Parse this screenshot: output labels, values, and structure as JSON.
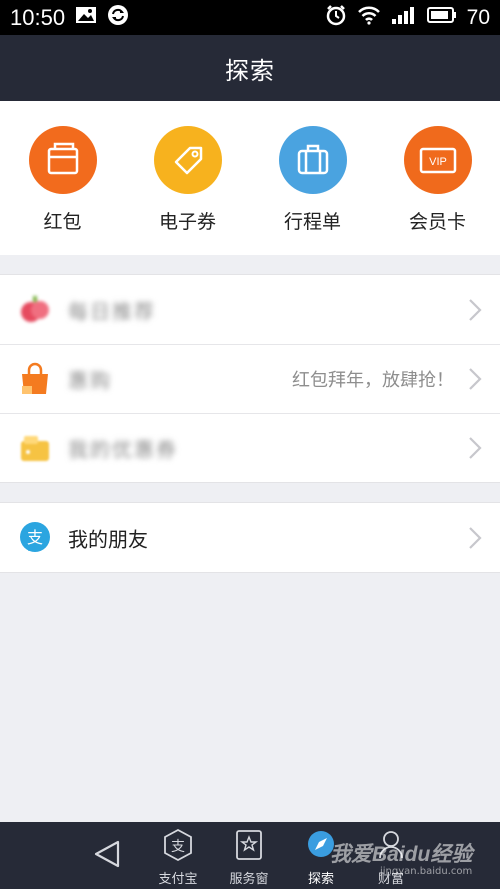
{
  "status_bar": {
    "time": "10:50",
    "battery": "70",
    "icons": [
      "image-icon",
      "sync-icon",
      "alarm-icon",
      "wifi-icon",
      "signal-icon",
      "battery-icon"
    ]
  },
  "header": {
    "title": "探索"
  },
  "quick_actions": [
    {
      "label": "红包",
      "icon": "red-envelope-icon",
      "color": "#f26b1d"
    },
    {
      "label": "电子券",
      "icon": "coupon-icon",
      "color": "#f7b21e"
    },
    {
      "label": "行程单",
      "icon": "luggage-icon",
      "color": "#4aa3e0"
    },
    {
      "label": "会员卡",
      "icon": "vip-card-icon",
      "color": "#f06a1c"
    }
  ],
  "list_group_1": [
    {
      "label": "每日推荐",
      "icon": "fruit-icon",
      "aside": ""
    },
    {
      "label": "惠购",
      "icon": "shopping-bag-icon",
      "aside": "红包拜年，放肆抢！"
    },
    {
      "label": "我的优惠券",
      "icon": "wallet-icon",
      "aside": ""
    }
  ],
  "list_group_2": [
    {
      "label": "我的朋友",
      "icon": "alipay-friends-icon",
      "aside": ""
    }
  ],
  "bottom_nav": {
    "items": [
      {
        "label": "支付宝",
        "icon": "alipay-icon"
      },
      {
        "label": "服务窗",
        "icon": "star-window-icon"
      },
      {
        "label": "探索",
        "icon": "explore-icon"
      },
      {
        "label": "财富",
        "icon": "wealth-icon"
      }
    ]
  },
  "watermark": {
    "text": "我爱Baidu经验",
    "url": "jingyan.baidu.com"
  },
  "colors": {
    "header_bg": "#262a37",
    "page_bg": "#eeeff3",
    "accent_orange": "#f26b1d",
    "accent_yellow": "#f7b21e",
    "accent_blue": "#4aa3e0"
  }
}
